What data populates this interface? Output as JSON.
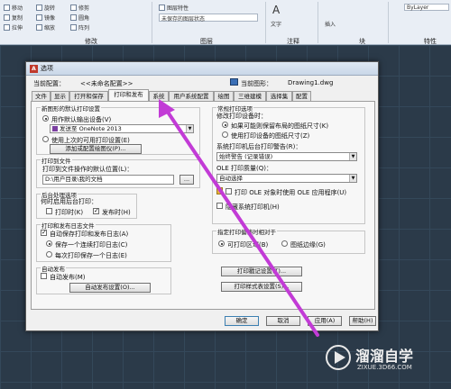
{
  "ribbon": {
    "row1": [
      "修改",
      "图层特性",
      "未保存的图层状态",
      "文字",
      "插入"
    ],
    "row2": [
      "移动",
      "复制",
      "拉伸",
      "修剪",
      "圆角"
    ],
    "row3": [
      "旋转",
      "镜像",
      "缩放",
      "阵列"
    ],
    "groups": {
      "modify": "修改",
      "layers": "图层",
      "annotation": "注释",
      "block": "块",
      "properties": "特性"
    },
    "bylayer": "ByLayer"
  },
  "dialog": {
    "title": "选项",
    "current_profile_label": "当前配置：",
    "current_profile_value": "<<未命名配置>>",
    "current_drawing_label": "当前图形：",
    "current_drawing_value": "Drawing1.dwg",
    "tabs": [
      "文件",
      "显示",
      "打开和保存",
      "打印和发布",
      "系统",
      "用户系统配置",
      "绘图",
      "三维建模",
      "选择集",
      "配置"
    ],
    "active_tab": "打印和发布",
    "default_output": {
      "title": "新图形的默认打印设置",
      "use_as_default_label": "用作默认输出设备(V)",
      "device_value": "发送至 OneNote 2013",
      "use_last_label": "使用上次的可用打印设置(E)",
      "add_plotter_button": "添加或配置绘图仪(P)..."
    },
    "plot_to_file": {
      "title": "打印到文件",
      "location_label": "打印到文件操作的默认位置(L)：",
      "location_value": "D:\\用户目录\\我的文档",
      "browse_button": "..."
    },
    "background": {
      "title": "后台处理选项",
      "when_label": "何时启用后台打印：",
      "plotting_label": "打印时(K)",
      "publishing_label": "发布时(H)"
    },
    "plot_log": {
      "title": "打印和发布日志文件",
      "auto_save_label": "自动保存打印和发布日志(A)",
      "continuous_label": "保存一个连续打印日志(C)",
      "per_plot_label": "每次打印保存一个日志(E)"
    },
    "auto_publish": {
      "title": "自动发布",
      "auto_publish_label": "自动发布(M)",
      "settings_button": "自动发布设置(O)..."
    },
    "general_options": {
      "title": "常规打印选项",
      "paper_size_label": "修改打印设备时：",
      "keep_layout_label": "如果可能则保留布局的图纸尺寸(K)",
      "use_device_label": "使用打印设备的图纸尺寸(Z)",
      "spooler_alert_label": "系统打印机后台打印警告(R)：",
      "spooler_alert_value": "始终警告 (记录错误)",
      "ole_quality_label": "OLE 打印质量(Q)：",
      "ole_quality_value": "自动选择",
      "use_ole_app_label": "打印 OLE 对象时使用 OLE 应用程序(U)",
      "hide_printers_label": "隐藏系统打印机(H)"
    },
    "plot_offset": {
      "title": "指定打印偏移时相对于",
      "printable_area_label": "可打印区域(B)",
      "paper_edge_label": "图纸边缘(G)"
    },
    "plot_stamp_button": "打印戳记设置(T)...",
    "plot_style_button": "打印样式表设置(S)...",
    "buttons": {
      "ok": "确定",
      "cancel": "取消",
      "apply": "应用(A)",
      "help": "帮助(H)"
    }
  },
  "watermark": {
    "brand": "溜溜自学",
    "url": "ZIXUE.3D66.COM"
  },
  "colors": {
    "arrow": "#c23bd6",
    "titlebar": "#c9d7e8",
    "canvas": "#2b3a49"
  }
}
